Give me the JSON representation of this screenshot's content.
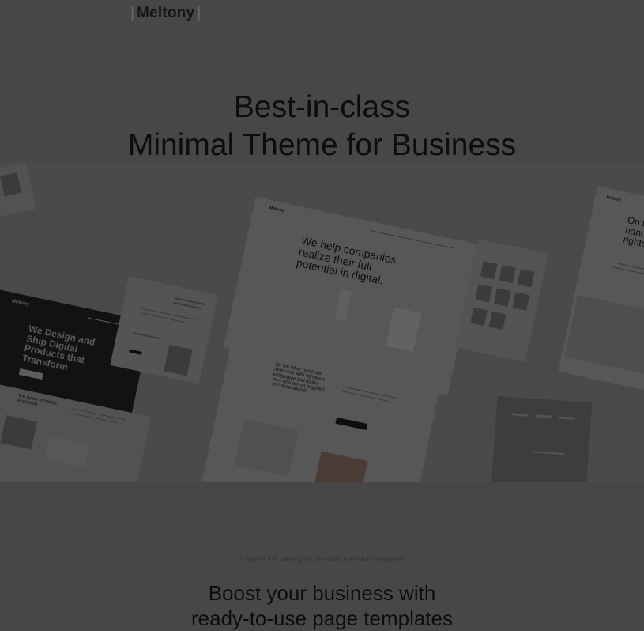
{
  "brand": {
    "name": "Meltony"
  },
  "hero": {
    "title_line1": "Best-in-class",
    "title_line2": "Minimal Theme for Business"
  },
  "showcase": {
    "center_headline": "We help companies realize their full potential in digital.",
    "center_logo": "Meltony",
    "center_subtext": "On the other hand, we denounce with righteous indignation and dislike men who are so beguiled and demoralized.",
    "dark_headline": "We Design and Ship Digital Products that Transform",
    "dark_logo": "Meltony",
    "left_subheadline": "We Apply a holistic Approach",
    "right_headline": "On the other hand, we righteous",
    "right_logo": "Meltony"
  },
  "templates": {
    "eyebrow": "Explore the variety of pre-built website templates",
    "heading_line1": "Boost your business with",
    "heading_line2": "ready-to-use page templates"
  }
}
